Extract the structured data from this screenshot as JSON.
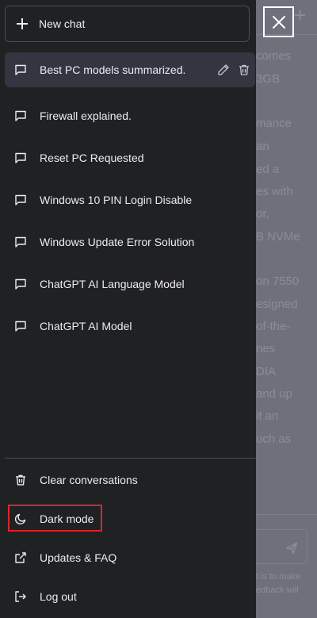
{
  "background_chat": {
    "lines": [
      "comes",
      "3GB",
      "mance",
      "an",
      "ed a",
      "es with",
      "or,",
      "B NVMe",
      "on 7550",
      "esigned",
      "of-the-",
      "nes",
      "DIA",
      "and up",
      "it an",
      "uch as"
    ],
    "footer_lines": [
      "t is to make",
      "edback will"
    ]
  },
  "sidebar": {
    "new_chat_label": "New chat",
    "history": [
      {
        "label": "Best PC models summarized.",
        "active": true
      },
      {
        "label": "Firewall explained.",
        "active": false
      },
      {
        "label": "Reset PC Requested",
        "active": false
      },
      {
        "label": "Windows 10 PIN Login Disable",
        "active": false
      },
      {
        "label": "Windows Update Error Solution",
        "active": false
      },
      {
        "label": "ChatGPT AI Language Model",
        "active": false
      },
      {
        "label": "ChatGPT AI Model",
        "active": false
      }
    ],
    "menu": [
      {
        "label": "Clear conversations",
        "icon": "trash-icon"
      },
      {
        "label": "Dark mode",
        "icon": "moon-icon",
        "highlighted": true
      },
      {
        "label": "Updates & FAQ",
        "icon": "external-link-icon"
      },
      {
        "label": "Log out",
        "icon": "log-out-icon"
      }
    ]
  },
  "colors": {
    "sidebar_bg": "#202123",
    "active_item_bg": "#343541",
    "text": "#ececf1",
    "highlight": "#d9262c",
    "overlay": "#6e707b"
  }
}
